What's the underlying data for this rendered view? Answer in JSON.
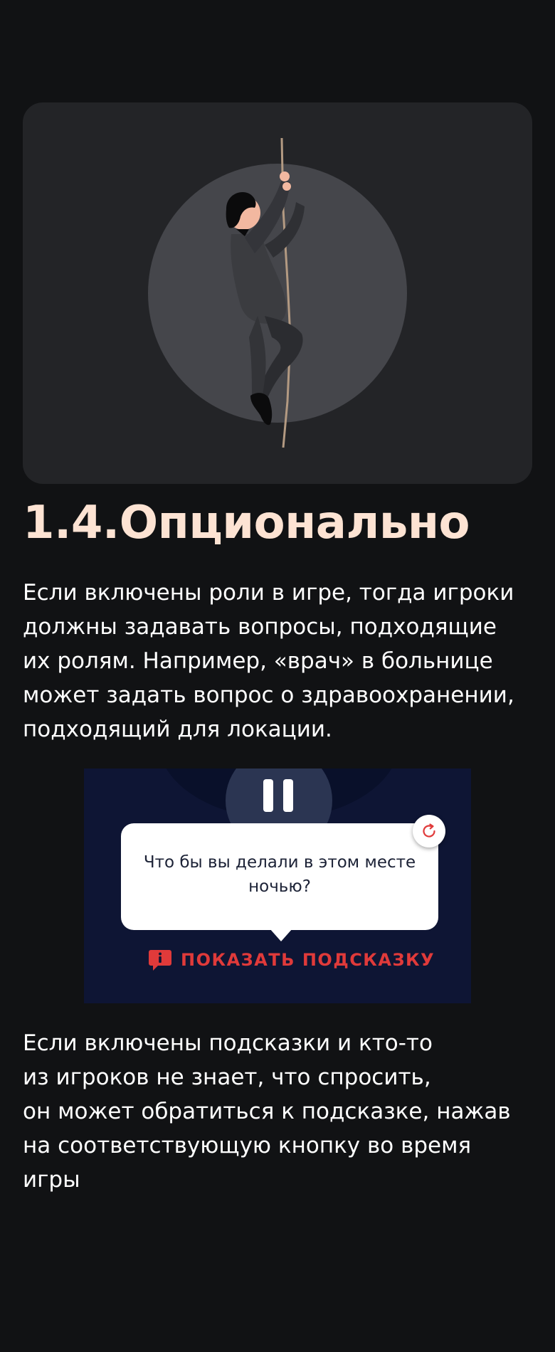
{
  "section": {
    "title": "1.4.Опционально",
    "paragraph1": "Если включены роли в игре, тогда игроки\nдолжны задавать вопросы, подходящие\nих ролям. Например, «врач» в больнице\nможет задать вопрос о здравоохранении,\nподходящий для локации.",
    "paragraph2": "Если включены подсказки и кто-то\nиз игроков не знает, что спросить,\nон может обратиться к подсказке, нажав\nна соответствующую кнопку во время\nигры"
  },
  "illustration": {
    "icon": "rope-climber-illustration"
  },
  "hint_preview": {
    "question": "Что бы вы делали в этом месте ночью?",
    "hint_button_label": "ПОКАЗАТЬ ПОДСКАЗКУ"
  },
  "colors": {
    "background": "#111214",
    "card": "#232427",
    "title": "#fde3d3",
    "preview_bg": "#0e1534",
    "accent_red": "#e03a3a"
  }
}
